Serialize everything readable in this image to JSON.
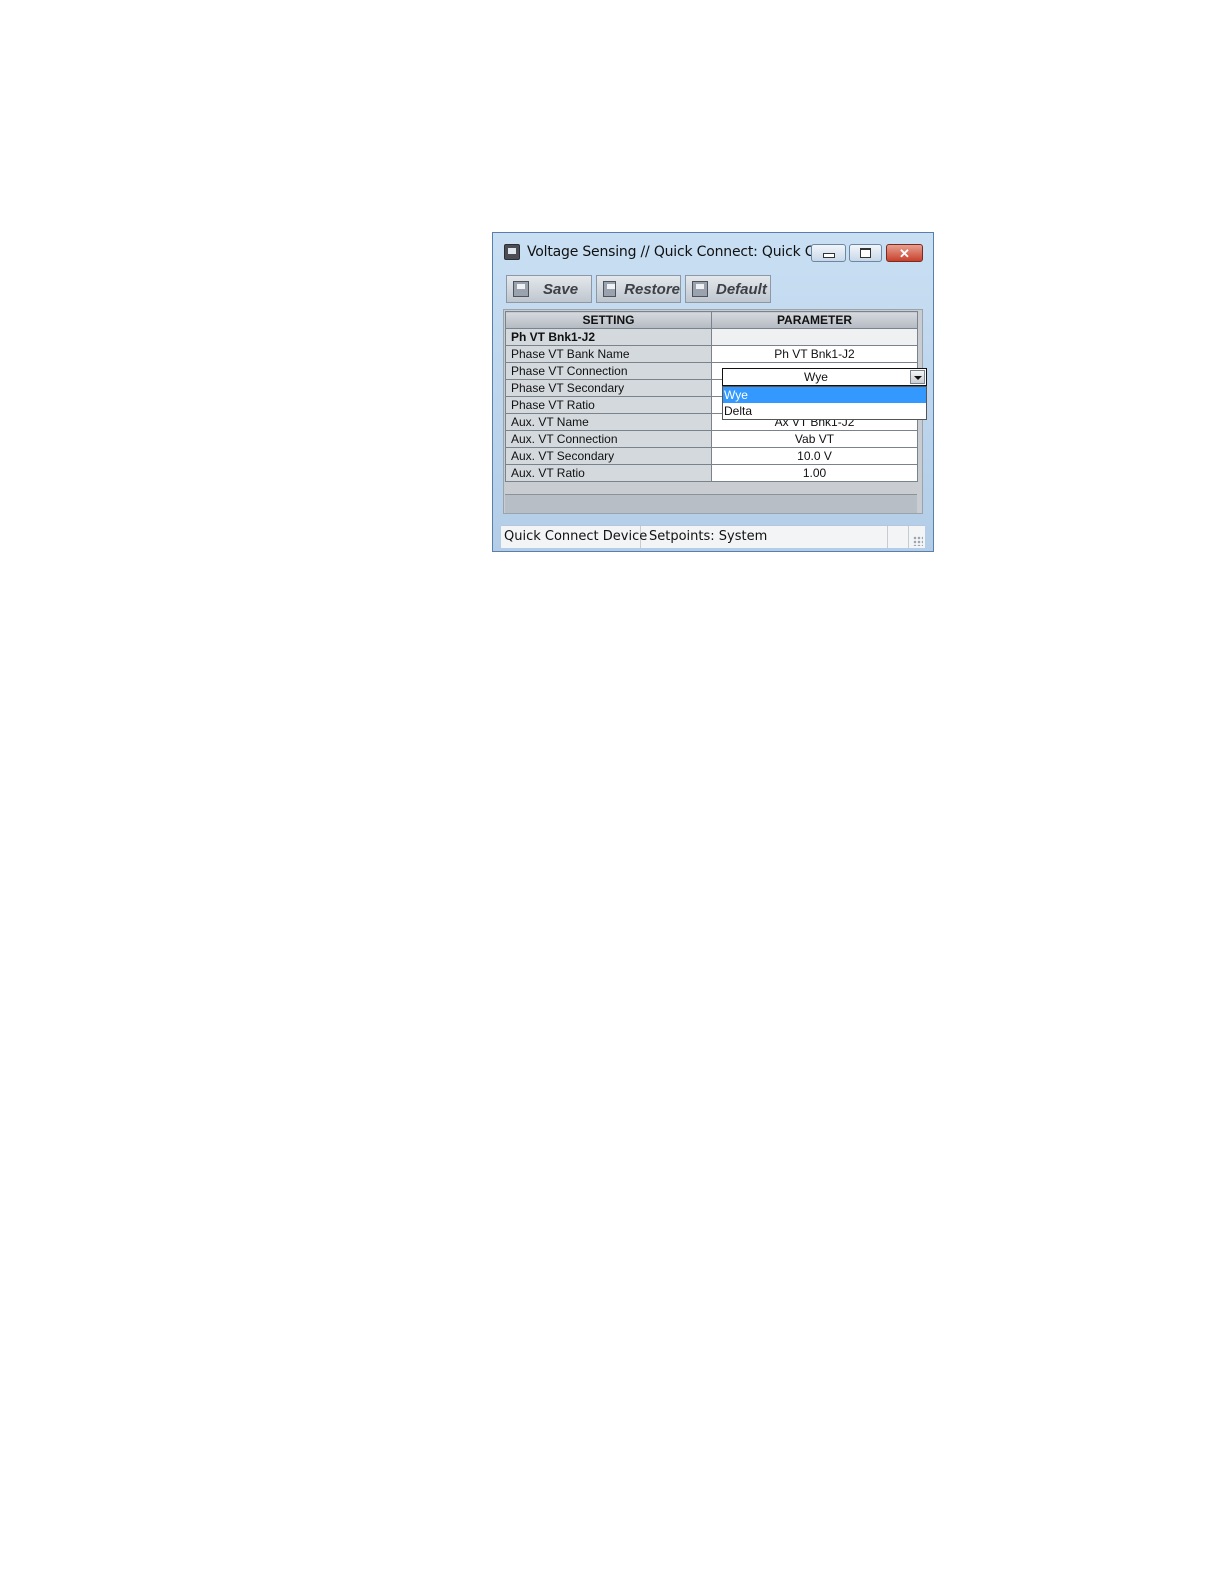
{
  "window": {
    "title": "Voltage Sensing // Quick Connect: Quick Co...",
    "controls": {
      "minimize": "minimize",
      "maximize": "maximize",
      "close": "✕"
    }
  },
  "toolbar": {
    "save_label": "Save",
    "restore_label": "Restore",
    "default_label": "Default"
  },
  "grid": {
    "headers": {
      "setting": "SETTING",
      "parameter": "PARAMETER"
    },
    "group_label": "Ph VT Bnk1-J2",
    "rows": [
      {
        "setting": "Phase VT Bank Name",
        "parameter": "Ph VT Bnk1-J2"
      },
      {
        "setting": "Phase VT Connection",
        "parameter": "Wye"
      },
      {
        "setting": "Phase VT Secondary",
        "parameter": ""
      },
      {
        "setting": "Phase VT Ratio",
        "parameter": ""
      },
      {
        "setting": "Aux. VT Name",
        "parameter": "Ax VT Bnk1-J2"
      },
      {
        "setting": "Aux. VT Connection",
        "parameter": "Vab VT"
      },
      {
        "setting": "Aux. VT Secondary",
        "parameter": "10.0 V"
      },
      {
        "setting": "Aux. VT Ratio",
        "parameter": "1.00"
      }
    ],
    "connection_combo": {
      "value": "Wye",
      "options": [
        "Wye",
        "Delta"
      ],
      "selected": "Wye"
    }
  },
  "statusbar": {
    "device": "Quick Connect Device",
    "path": "Setpoints: System"
  },
  "colors": {
    "selection": "#3399ff",
    "close_button": "#c8412d",
    "window_frame": "#b3cde8"
  }
}
